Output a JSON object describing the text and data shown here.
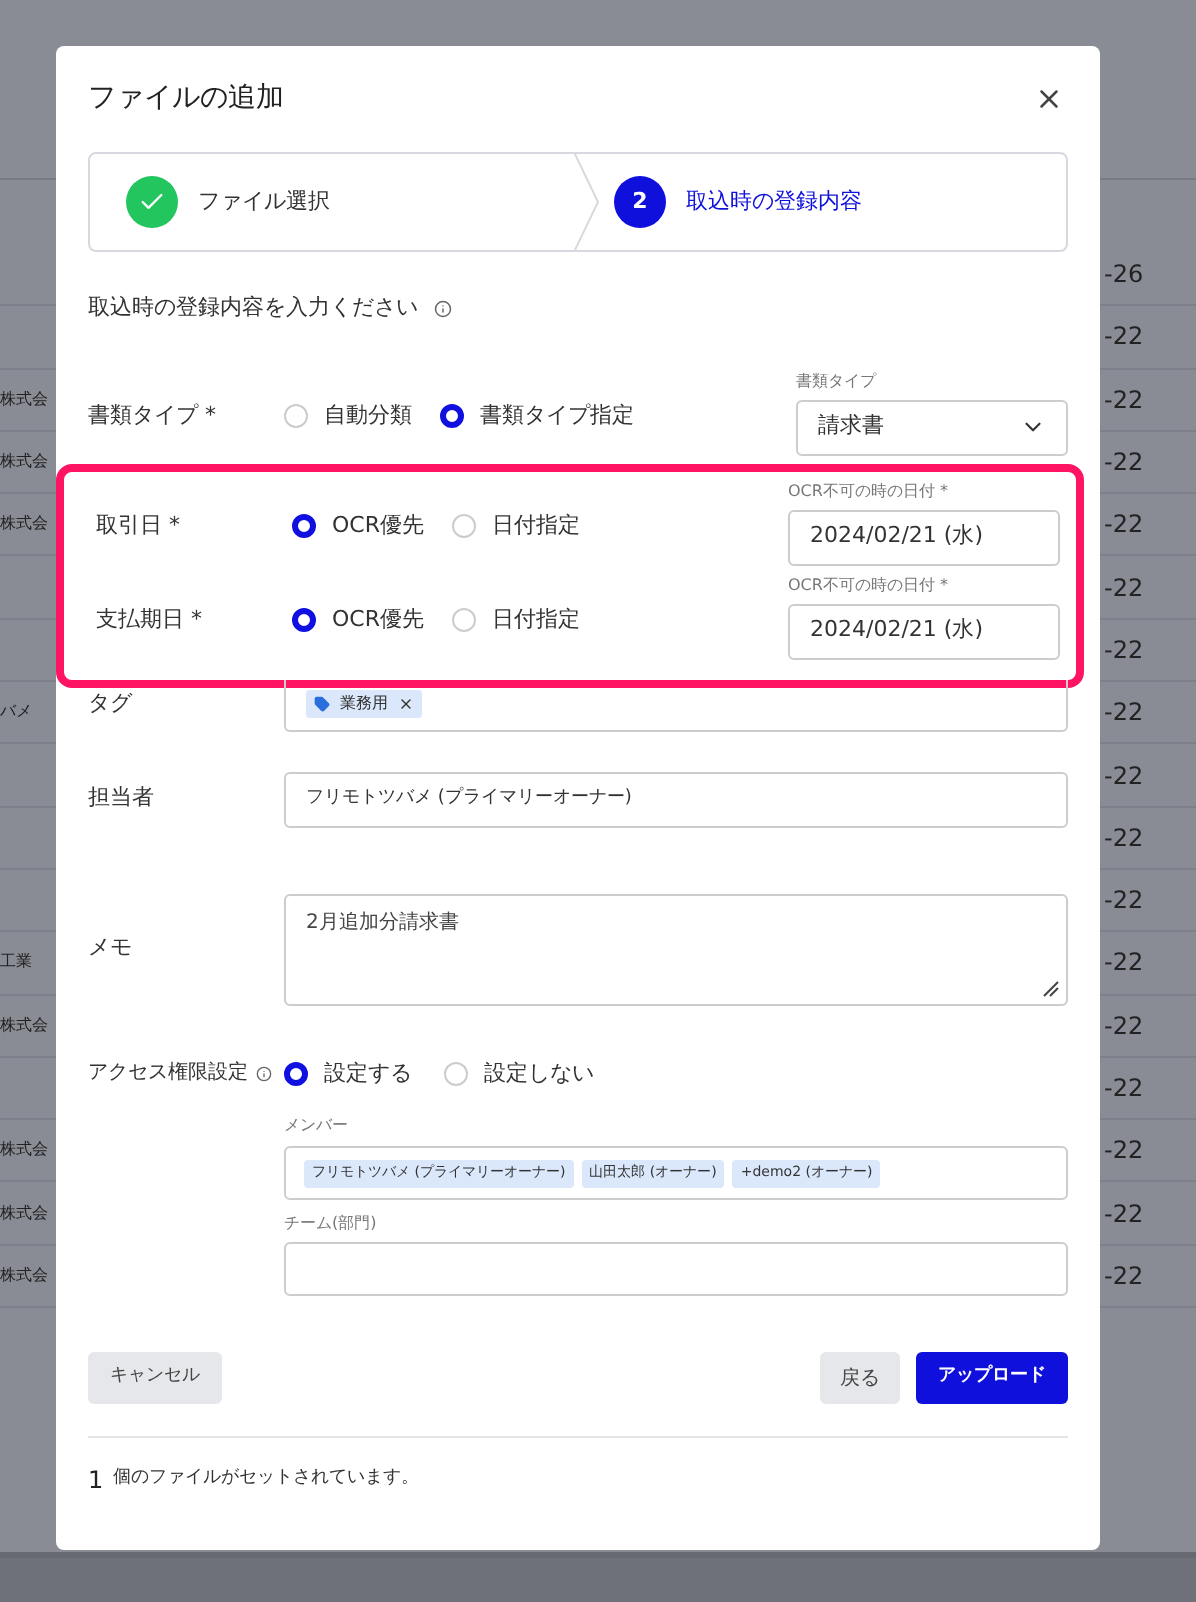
{
  "background_table": {
    "rows": [
      {
        "column_1": "",
        "column_2": "-26"
      },
      {
        "column_1": "",
        "column_2": "-22"
      },
      {
        "column_1": "株式会",
        "column_2": "-22"
      },
      {
        "column_1": "株式会",
        "column_2": "-22"
      },
      {
        "column_1": "株式会",
        "column_2": "-22"
      },
      {
        "column_1": "",
        "column_2": "-22"
      },
      {
        "column_1": "",
        "column_2": "-22"
      },
      {
        "column_1": "バメ",
        "column_2": "-22"
      },
      {
        "column_1": "",
        "column_2": "-22"
      },
      {
        "column_1": "",
        "column_2": "-22"
      },
      {
        "column_1": "",
        "column_2": "-22"
      },
      {
        "column_1": "工業",
        "column_2": "-22"
      },
      {
        "column_1": "株式会",
        "column_2": "-22"
      },
      {
        "column_1": "",
        "column_2": "-22"
      },
      {
        "column_1": "株式会",
        "column_2": "-22"
      },
      {
        "column_1": "株式会",
        "column_2": "-22"
      },
      {
        "column_1": "株式会",
        "column_2": "-22"
      }
    ]
  },
  "dialog": {
    "title": "ファイルの追加",
    "steps": [
      {
        "label": "ファイル選択",
        "done": true,
        "selected": false
      },
      {
        "number": "2",
        "label": "取込時の登録内容",
        "done": false,
        "selected": true
      }
    ],
    "instruction": "取込時の登録内容を入力ください",
    "document_type": {
      "label": "書類タイプ *",
      "options": [
        {
          "label": "自動分類",
          "selected": false
        },
        {
          "label": "書類タイプ指定",
          "selected": true
        }
      ],
      "field_label": "書類タイプ",
      "value": "請求書"
    },
    "highlight": true,
    "date_rows": [
      {
        "label": "取引日 *",
        "options": [
          {
            "label": "OCR優先",
            "selected": true
          },
          {
            "label": "日付指定",
            "selected": false
          }
        ],
        "field_label": "OCR不可の時の日付 *",
        "value": "2024/02/21 (水)"
      },
      {
        "label": "支払期日 *",
        "options": [
          {
            "label": "OCR優先",
            "selected": true
          },
          {
            "label": "日付指定",
            "selected": false
          }
        ],
        "field_label": "OCR不可の時の日付 *",
        "value": "2024/02/21 (水)"
      }
    ],
    "tags": {
      "label": "タグ",
      "items": [
        "業務用"
      ]
    },
    "assignee": {
      "label": "担当者",
      "value": "フリモトツバメ (プライマリーオーナー)"
    },
    "memo": {
      "label": "メモ",
      "value": "2月追加分請求書"
    },
    "access": {
      "label": "アクセス権限設定",
      "options": [
        {
          "label": "設定する",
          "selected": true
        },
        {
          "label": "設定しない",
          "selected": false
        }
      ],
      "members_label": "メンバー",
      "members": [
        "フリモトツバメ (プライマリーオーナー)",
        "山田太郎 (オーナー)",
        "+demo2 (オーナー)"
      ],
      "team_label": "チーム(部門)"
    },
    "buttons": {
      "cancel": "キャンセル",
      "back": "戻る",
      "upload": "アップロード"
    },
    "footer": {
      "count": "1",
      "text": "個のファイルがセットされています。"
    }
  }
}
